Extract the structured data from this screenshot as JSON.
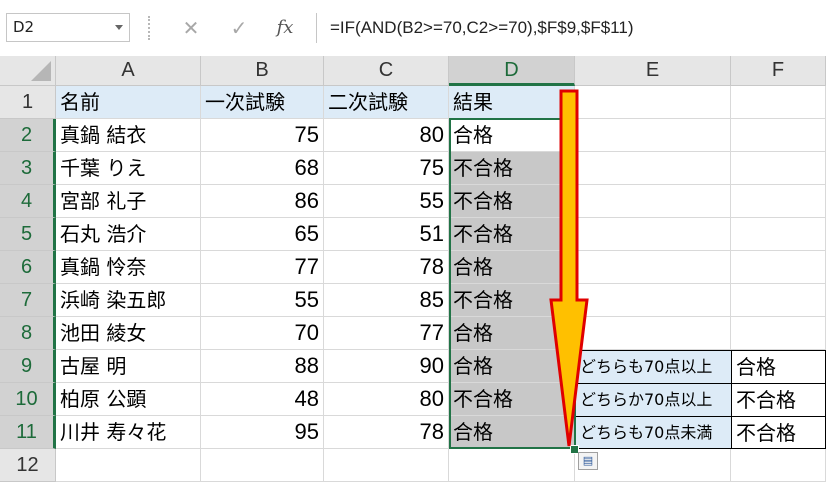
{
  "formula_bar": {
    "name_box": "D2",
    "cancel_icon": "✕",
    "enter_icon": "✓",
    "fx_label": "fx",
    "formula": "=IF(AND(B2>=70,C2>=70),$F$9,$F$11)"
  },
  "columns": [
    "A",
    "B",
    "C",
    "D",
    "E",
    "F"
  ],
  "selected_column": "D",
  "rows": [
    "1",
    "2",
    "3",
    "4",
    "5",
    "6",
    "7",
    "8",
    "9",
    "10",
    "11",
    "12"
  ],
  "selected_rows_from": "2",
  "selected_rows_to": "11",
  "headers": {
    "name": "名前",
    "exam1": "一次試験",
    "exam2": "二次試験",
    "result": "結果"
  },
  "data_rows": [
    {
      "name": "真鍋 結衣",
      "exam1": "75",
      "exam2": "80",
      "result": "合格"
    },
    {
      "name": "千葉 りえ",
      "exam1": "68",
      "exam2": "75",
      "result": "不合格"
    },
    {
      "name": "宮部 礼子",
      "exam1": "86",
      "exam2": "55",
      "result": "不合格"
    },
    {
      "name": "石丸 浩介",
      "exam1": "65",
      "exam2": "51",
      "result": "不合格"
    },
    {
      "name": "真鍋 怜奈",
      "exam1": "77",
      "exam2": "78",
      "result": "合格"
    },
    {
      "name": "浜崎 染五郎",
      "exam1": "55",
      "exam2": "85",
      "result": "不合格"
    },
    {
      "name": "池田 綾女",
      "exam1": "70",
      "exam2": "77",
      "result": "合格"
    },
    {
      "name": "古屋 明",
      "exam1": "88",
      "exam2": "90",
      "result": "合格"
    },
    {
      "name": "柏原 公顕",
      "exam1": "48",
      "exam2": "80",
      "result": "不合格"
    },
    {
      "name": "川井 寿々花",
      "exam1": "95",
      "exam2": "78",
      "result": "合格"
    }
  ],
  "criteria_table": [
    {
      "condition": "どちらも70点以上",
      "result": "合格"
    },
    {
      "condition": "どちらか70点以上",
      "result": "不合格"
    },
    {
      "condition": "どちらも70点未満",
      "result": "不合格"
    }
  ],
  "colors": {
    "header_fill": "#ddebf7",
    "selected_fill": "#c8c8c8",
    "selection_border": "#217346",
    "arrow_fill": "#ffc000",
    "arrow_stroke": "#e00000"
  }
}
